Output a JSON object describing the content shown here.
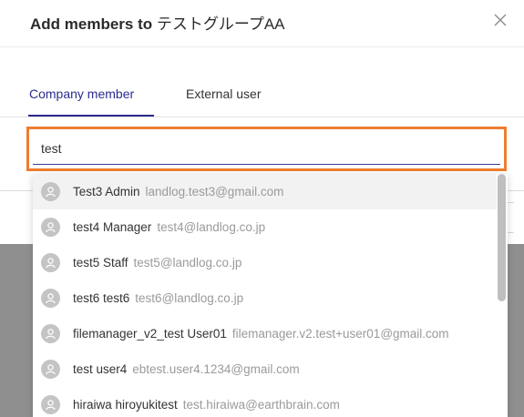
{
  "modal": {
    "title_prefix": "Add members to ",
    "group_name": "テストグループAA",
    "close_icon": "close-icon"
  },
  "tabs": [
    {
      "label": "Company member",
      "selected": true
    },
    {
      "label": "External user",
      "selected": false
    }
  ],
  "search": {
    "value": "test",
    "placeholder": ""
  },
  "options": [
    {
      "name": "Test3 Admin",
      "email": "landlog.test3@gmail.com"
    },
    {
      "name": "test4 Manager",
      "email": "test4@landlog.co.jp"
    },
    {
      "name": "test5 Staff",
      "email": "test5@landlog.co.jp"
    },
    {
      "name": "test6 test6",
      "email": "test6@landlog.co.jp"
    },
    {
      "name": "filemanager_v2_test User01",
      "email": "filemanager.v2.test+user01@gmail.com"
    },
    {
      "name": "test user4",
      "email": "ebtest.user4.1234@gmail.com"
    },
    {
      "name": "hiraiwa hiroyukitest",
      "email": "test.hiraiwa@earthbrain.com"
    }
  ],
  "colors": {
    "highlight": "#ee7d30",
    "tab_active": "#2a2a8c",
    "avatar": "#c4c4c4"
  }
}
